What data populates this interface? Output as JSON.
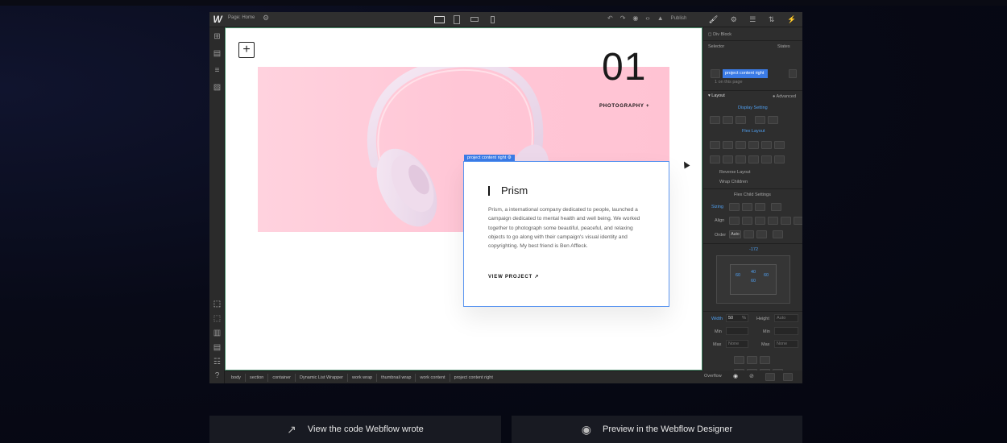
{
  "topbar": {
    "logo": "W",
    "page_label": "Page: Home",
    "publish_label": "Publish"
  },
  "canvas": {
    "number": "01",
    "category": "PHOTOGRAPHY +",
    "card_tag": "project content right",
    "card_title": "Prism",
    "card_description": "Prism, a international company dedicated to people, launched a campaign dedicated to mental health and well being. We worked together to photograph some beautiful, peaceful, and relaxing objects to go along with their campaign's visual identity and copyrighting. My best friend is Ben Affleck.",
    "card_link": "VIEW PROJECT ↗"
  },
  "breadcrumbs": [
    "body",
    "section",
    "container",
    "Dynamic List Wrapper",
    "work wrap",
    "thumbnail wrap",
    "work content",
    "project content right"
  ],
  "panel": {
    "element_type": "Div Block",
    "selector_label": "Selector",
    "states_label": "States",
    "selector_class": "project content right",
    "on_page": "1 on this page",
    "layout_title": "Layout",
    "advanced_label": "Advanced",
    "display_setting": "Display Setting",
    "flex_layout": "Flex Layout",
    "reverse_layout": "Reverse Layout",
    "wrap_children": "Wrap Children",
    "flex_child": "Flex Child Settings",
    "sizing": "Sizing",
    "align": "Align",
    "order": "Order",
    "order_value": "Auto",
    "margin_top": "-172",
    "padding_top": "40",
    "padding_left": "60",
    "padding_right": "60",
    "padding_bottom": "60",
    "width_label": "Width",
    "width_value": "50",
    "width_unit": "%",
    "height_label": "Height",
    "height_value": "Auto",
    "min_label": "Min",
    "max_label": "Max",
    "max_value": "None",
    "overflow_label": "Overflow"
  },
  "bottom": {
    "code_label": "View the code Webflow wrote",
    "preview_label": "Preview in the Webflow Designer"
  }
}
